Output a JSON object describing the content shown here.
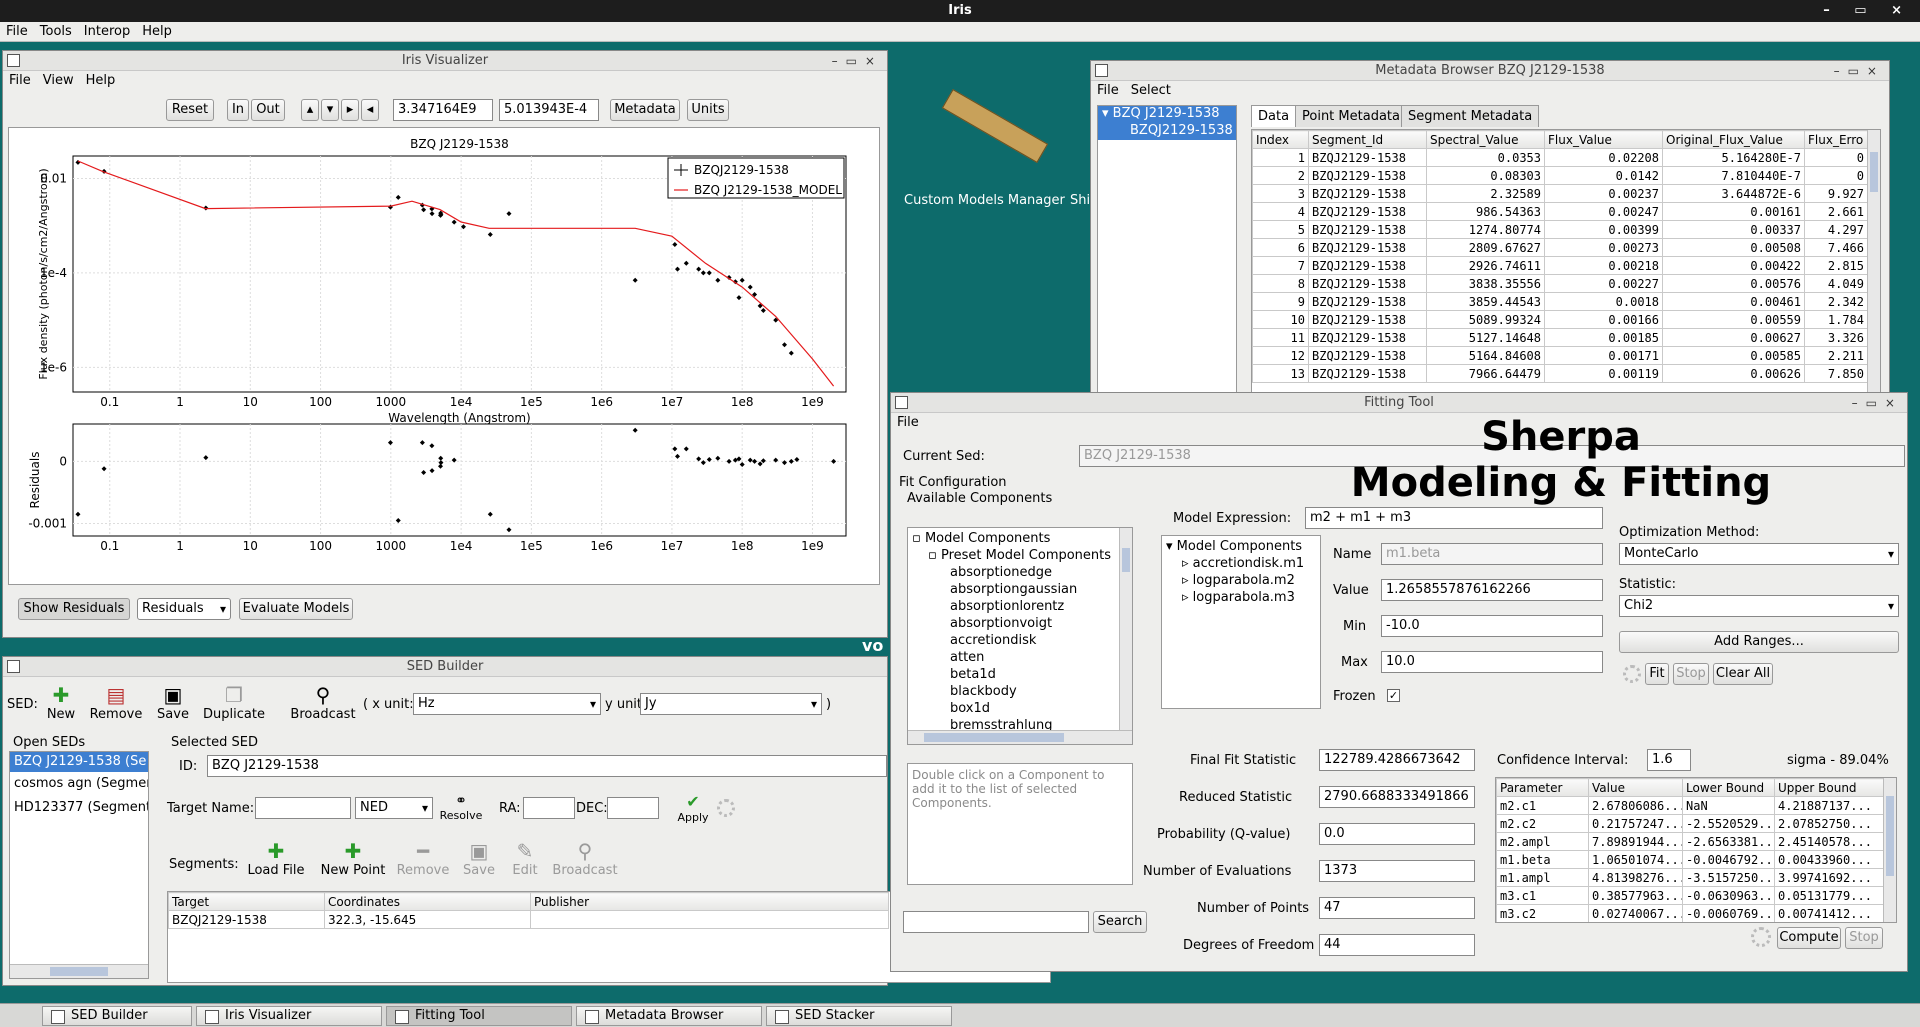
{
  "app": {
    "title": "Iris",
    "menu": [
      "File",
      "Tools",
      "Interop",
      "Help"
    ],
    "controls": "– ▭ ×"
  },
  "desktop": {
    "custom_models": "Custom Models Manager",
    "shi_partial": "Shi",
    "vo_partial": "vo"
  },
  "visualizer": {
    "title": "Iris Visualizer",
    "menu": [
      "File",
      "View",
      "Help"
    ],
    "buttons": {
      "reset": "Reset",
      "in": "In",
      "out": "Out",
      "metadata": "Metadata",
      "units": "Units"
    },
    "arrows": [
      "▴",
      "▾",
      "▸",
      "◂"
    ],
    "coord_x": "3.347164E9",
    "coord_y": "5.013943E-4",
    "bottom": {
      "show_residuals": "Show Residuals",
      "residuals_select": "Residuals",
      "evaluate": "Evaluate Models"
    }
  },
  "chart_data": [
    {
      "type": "scatter",
      "title": "BZQ J2129-1538",
      "xlabel": "Wavelength (Angstrom)",
      "ylabel": "Flux density (photon/s/cm2/Angstrom)",
      "xscale": "log",
      "yscale": "log",
      "xlim": [
        0.03,
        3000000000.0
      ],
      "ylim": [
        3e-07,
        0.03
      ],
      "x_ticks": [
        "0.1",
        "1",
        "10",
        "100",
        "1000",
        "1e4",
        "1e5",
        "1e6",
        "1e7",
        "1e8",
        "1e9"
      ],
      "y_ticks": [
        "0.01",
        "1e-4",
        "1e-6"
      ],
      "legend": {
        "placement": "top-right",
        "entries": [
          "BZQJ2129-1538",
          "BZQ J2129-1538_MODEL"
        ]
      },
      "series": [
        {
          "name": "BZQJ2129-1538",
          "points": [
            [
              0.0353,
              0.022
            ],
            [
              0.083,
              0.0142
            ],
            [
              2.33,
              0.00237
            ],
            [
              987,
              0.00247
            ],
            [
              1275,
              0.00399
            ],
            [
              2810,
              0.00273
            ],
            [
              2927,
              0.00218
            ],
            [
              3838,
              0.00227
            ],
            [
              3859,
              0.0018
            ],
            [
              5090,
              0.00166
            ],
            [
              5127,
              0.00185
            ],
            [
              5165,
              0.00171
            ],
            [
              7967,
              0.00119
            ],
            [
              10800,
              0.00095
            ],
            [
              26000,
              0.00065
            ],
            [
              48000,
              0.0018
            ],
            [
              3000000.0,
              7e-05
            ],
            [
              11000000.0,
              0.0004
            ],
            [
              12000000.0,
              0.00012
            ],
            [
              16000000.0,
              0.00016
            ],
            [
              24000000.0,
              0.00012
            ],
            [
              28000000.0,
              0.0001
            ],
            [
              34000000.0,
              0.0001
            ],
            [
              45000000.0,
              7e-05
            ],
            [
              65000000.0,
              8e-05
            ],
            [
              80000000.0,
              6.5e-05
            ],
            [
              90000000.0,
              3e-05
            ],
            [
              100000000.0,
              7e-05
            ],
            [
              130000000.0,
              5e-05
            ],
            [
              150000000.0,
              3.5e-05
            ],
            [
              180000000.0,
              2e-05
            ],
            [
              200000000.0,
              1.6e-05
            ],
            [
              300000000.0,
              1e-05
            ],
            [
              400000000.0,
              3e-06
            ],
            [
              500000000.0,
              2e-06
            ],
            [
              2000000000.0,
              2e-07
            ]
          ]
        },
        {
          "name": "BZQ J2129-1538_MODEL",
          "points": [
            [
              0.0353,
              0.0235
            ],
            [
              0.08,
              0.014
            ],
            [
              2.3,
              0.0023
            ],
            [
              1000,
              0.0026
            ],
            [
              2000,
              0.0033
            ],
            [
              5000,
              0.0022
            ],
            [
              10000,
              0.0012
            ],
            [
              25000,
              0.00088
            ],
            [
              3000000.0,
              0.00088
            ],
            [
              10000000.0,
              0.0006
            ],
            [
              30000000.0,
              0.00016
            ],
            [
              100000000.0,
              5e-05
            ],
            [
              300000000.0,
              1.2e-05
            ],
            [
              1000000000.0,
              1.5e-06
            ],
            [
              2000000000.0,
              4e-07
            ]
          ]
        }
      ]
    },
    {
      "type": "scatter",
      "title": "",
      "xlabel": "",
      "ylabel": "Residuals",
      "xscale": "log",
      "xlim": [
        0.03,
        3000000000.0
      ],
      "ylim": [
        -0.0012,
        0.0006
      ],
      "x_ticks": [
        "0.1",
        "1",
        "10",
        "100",
        "1000",
        "1e4",
        "1e5",
        "1e6",
        "1e7",
        "1e8",
        "1e9"
      ],
      "y_ticks": [
        "0",
        "-0.001"
      ],
      "series": [
        {
          "name": "",
          "points": [
            [
              0.0353,
              -0.00085
            ],
            [
              0.083,
              -0.00012
            ],
            [
              2.33,
              6e-05
            ],
            [
              987,
              0.0003
            ],
            [
              1275,
              -0.00095
            ],
            [
              2810,
              0.0003
            ],
            [
              2927,
              -0.00018
            ],
            [
              3838,
              0.00025
            ],
            [
              3859,
              -0.00015
            ],
            [
              5090,
              -8e-05
            ],
            [
              5127,
              5e-05
            ],
            [
              5165,
              -2e-05
            ],
            [
              7967,
              2e-05
            ],
            [
              26000,
              -0.00085
            ],
            [
              48000,
              -0.0011
            ],
            [
              3000000.0,
              0.0005
            ],
            [
              11000000.0,
              0.0002
            ],
            [
              12000000.0,
              8e-05
            ],
            [
              16000000.0,
              0.0002
            ],
            [
              24000000.0,
              4e-05
            ],
            [
              28000000.0,
              -2e-05
            ],
            [
              34000000.0,
              3e-05
            ],
            [
              45000000.0,
              5e-05
            ],
            [
              65000000.0,
              0.0
            ],
            [
              80000000.0,
              2e-05
            ],
            [
              90000000.0,
              4e-05
            ],
            [
              100000000.0,
              -5e-05
            ],
            [
              130000000.0,
              2e-05
            ],
            [
              150000000.0,
              0.0
            ],
            [
              180000000.0,
              -4e-05
            ],
            [
              200000000.0,
              1e-05
            ],
            [
              300000000.0,
              2e-05
            ],
            [
              400000000.0,
              -2e-05
            ],
            [
              500000000.0,
              0.0
            ],
            [
              600000000.0,
              3e-05
            ],
            [
              2000000000.0,
              0.0
            ]
          ]
        }
      ]
    }
  ],
  "metadata_browser": {
    "title": "Metadata Browser BZQ J2129-1538",
    "menu": [
      "File",
      "Select"
    ],
    "tree": [
      "BZQ J2129-1538",
      "BZQJ2129-1538"
    ],
    "tabs": [
      "Data",
      "Point Metadata",
      "Segment Metadata"
    ],
    "columns": [
      "Index",
      "Segment_Id",
      "Spectral_Value",
      "Flux_Value",
      "Original_Flux_Value",
      "Flux_Erro"
    ],
    "rows": [
      [
        "1",
        "BZQJ2129-1538",
        "0.0353",
        "0.02208",
        "5.164280E-7",
        "0"
      ],
      [
        "2",
        "BZQJ2129-1538",
        "0.08303",
        "0.0142",
        "7.810440E-7",
        "0"
      ],
      [
        "3",
        "BZQJ2129-1538",
        "2.32589",
        "0.00237",
        "3.644872E-6",
        "9.927"
      ],
      [
        "4",
        "BZQJ2129-1538",
        "986.54363",
        "0.00247",
        "0.00161",
        "2.661"
      ],
      [
        "5",
        "BZQJ2129-1538",
        "1274.80774",
        "0.00399",
        "0.00337",
        "4.297"
      ],
      [
        "6",
        "BZQJ2129-1538",
        "2809.67627",
        "0.00273",
        "0.00508",
        "7.466"
      ],
      [
        "7",
        "BZQJ2129-1538",
        "2926.74611",
        "0.00218",
        "0.00422",
        "2.815"
      ],
      [
        "8",
        "BZQJ2129-1538",
        "3838.35556",
        "0.00227",
        "0.00576",
        "4.049"
      ],
      [
        "9",
        "BZQJ2129-1538",
        "3859.44543",
        "0.0018",
        "0.00461",
        "2.342"
      ],
      [
        "10",
        "BZQJ2129-1538",
        "5089.99324",
        "0.00166",
        "0.00559",
        "1.784"
      ],
      [
        "11",
        "BZQJ2129-1538",
        "5127.14648",
        "0.00185",
        "0.00627",
        "3.326"
      ],
      [
        "12",
        "BZQJ2129-1538",
        "5164.84608",
        "0.00171",
        "0.00585",
        "2.211"
      ],
      [
        "13",
        "BZQJ2129-1538",
        "7966.64479",
        "0.00119",
        "0.00626",
        "7.850"
      ]
    ]
  },
  "sed_builder": {
    "title": "SED Builder",
    "sed_label": "SED:",
    "tools": [
      "New",
      "Remove",
      "Save",
      "Duplicate",
      "Broadcast"
    ],
    "x_unit_label": "( x unit:",
    "x_unit": "Hz",
    "y_unit_label": "y unit",
    "y_unit": "Jy",
    "close_paren": ")",
    "open_seds_label": "Open SEDs",
    "open_seds": [
      "BZQ J2129-1538 (Se",
      "cosmos agn (Segmen",
      "HD123377 (Segment"
    ],
    "selected_sed_label": "Selected SED",
    "id_label": "ID:",
    "id_value": "BZQ J2129-1538",
    "target_name_label": "Target Name:",
    "target_name": "",
    "resolver": "NED",
    "resolve": "Resolve",
    "ra_label": "RA:",
    "dec_label": "DEC:",
    "apply": "Apply",
    "segments_label": "Segments:",
    "segment_tools": [
      "Load File",
      "New Point",
      "Remove",
      "Save",
      "Edit",
      "Broadcast"
    ],
    "seg_columns": [
      "Target",
      "Coordinates",
      "Publisher"
    ],
    "seg_rows": [
      [
        "BZQJ2129-1538",
        "322.3, -15.645",
        ""
      ]
    ]
  },
  "fitting": {
    "title": "Fitting Tool",
    "menu": [
      "File"
    ],
    "current_sed_label": "Current Sed:",
    "current_sed": "BZQ J2129-1538",
    "banner_1": "Sherpa",
    "banner_2": "Modeling & Fitting",
    "fit_config": "Fit Configuration",
    "available": "Available Components",
    "tree_root": "Model Components",
    "tree_preset": "Preset Model Components",
    "components": [
      "absorptionedge",
      "absorptiongaussian",
      "absorptionlorentz",
      "absorptionvoigt",
      "accretiondisk",
      "atten",
      "beta1d",
      "blackbody",
      "box1d",
      "bremsstrahlung",
      "brokenpowerlaw"
    ],
    "hint": "Double click on a Component to add it to the list of selected Components.",
    "search": "Search",
    "model_expr_label": "Model Expression:",
    "model_expr": "m2 + m1 + m3",
    "selected_root": "Model Components",
    "selected": [
      "accretiondisk.m1",
      "logparabola.m2",
      "logparabola.m3"
    ],
    "name_label": "Name",
    "name_value": "m1.beta",
    "value_label": "Value",
    "value": "1.2658557876162266",
    "min_label": "Min",
    "min": "-10.0",
    "max_label": "Max",
    "max": "10.0",
    "frozen_label": "Frozen",
    "opt_label": "Optimization Method:",
    "opt": "MonteCarlo",
    "stat_label": "Statistic:",
    "stat": "Chi2",
    "add_ranges": "Add Ranges...",
    "fit": "Fit",
    "stop": "Stop",
    "clear_all": "Clear All",
    "results": [
      [
        "Final Fit Statistic",
        "122789.4286673642"
      ],
      [
        "Reduced Statistic",
        "2790.6688333491866"
      ],
      [
        "Probability (Q-value)",
        "0.0"
      ],
      [
        "Number of Evaluations",
        "1373"
      ],
      [
        "Number of Points",
        "47"
      ],
      [
        "Degrees of Freedom",
        "44"
      ]
    ],
    "ci_label": "Confidence Interval:",
    "ci": "1.6",
    "sigma": "sigma - 89.04%",
    "param_columns": [
      "Parameter",
      "Value",
      "Lower Bound",
      "Upper Bound"
    ],
    "params": [
      [
        "m2.c1",
        "2.67806086...",
        "NaN",
        "4.21887137..."
      ],
      [
        "m2.c2",
        "0.21757247...",
        "-2.5520529...",
        "2.07852750..."
      ],
      [
        "m2.ampl",
        "7.89891944...",
        "-2.6563381...",
        "2.45140578..."
      ],
      [
        "m1.beta",
        "1.06501074...",
        "-0.0046792...",
        "0.00433960..."
      ],
      [
        "m1.ampl",
        "4.81398276...",
        "-3.5157250...",
        "3.99741692..."
      ],
      [
        "m3.c1",
        "0.38577963...",
        "-0.0630963...",
        "0.05131779..."
      ],
      [
        "m3.c2",
        "0.02740067...",
        "-0.0060769...",
        "0.00741412..."
      ]
    ],
    "compute": "Compute",
    "stop2": "Stop"
  },
  "taskbar": [
    "SED Builder",
    "Iris Visualizer",
    "Fitting Tool",
    "Metadata Browser BZQ...",
    "SED Stacker"
  ]
}
